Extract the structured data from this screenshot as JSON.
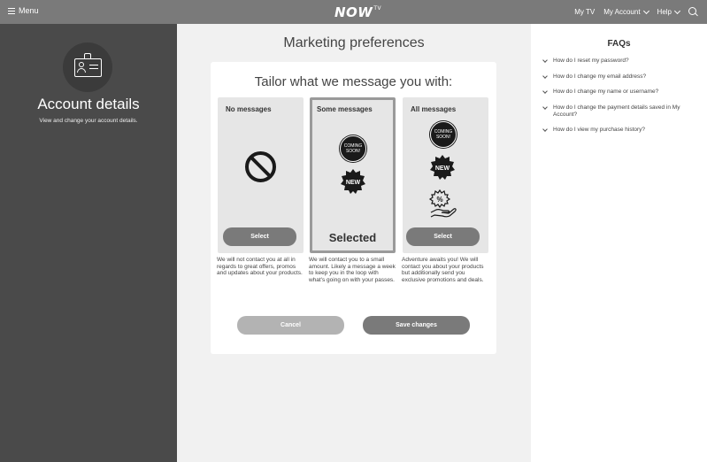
{
  "header": {
    "menu_label": "Menu",
    "logo_text": "NOW",
    "logo_sup": "TV",
    "nav": [
      {
        "label": "My TV"
      },
      {
        "label": "My Account"
      },
      {
        "label": "Help"
      }
    ],
    "icons": [
      "hamburger-icon",
      "chevron-down-icon",
      "search-icon"
    ]
  },
  "sidebar": {
    "title": "Account details",
    "subtitle": "View and change your account details.",
    "icon": "account-card-icon"
  },
  "main": {
    "title": "Marketing preferences",
    "card_heading": "Tailor what we message you with:",
    "options": [
      {
        "label": "No messages",
        "button": "Select",
        "description": "We will not contact you at all in regards to great offers, promos and updates about your products.",
        "icons": [
          "no-entry-icon"
        ]
      },
      {
        "label": "Some messages",
        "selected_text": "Selected",
        "description": "We will contact you to a small amount. Likely a message a week to keep you in the loop with what's going on with your passes.",
        "icons": [
          "coming-soon-icon",
          "new-badge-icon"
        ],
        "coming_soon": "COMING SOON!",
        "new": "NEW"
      },
      {
        "label": "All messages",
        "button": "Select",
        "description": "Adventure awaits you! We will contact you about your products but additionally send you exclusive promotions and deals.",
        "icons": [
          "coming-soon-icon",
          "new-badge-icon",
          "discount-hand-icon"
        ],
        "coming_soon": "COMING SOON!",
        "new": "NEW"
      }
    ],
    "cancel_label": "Cancel",
    "save_label": "Save changes"
  },
  "faq": {
    "title": "FAQs",
    "items": [
      {
        "label": "How do I reset my password?"
      },
      {
        "label": "How do I change my email address?"
      },
      {
        "label": "How do I change my name or username?"
      },
      {
        "label": "How do I change the payment details saved in My Account?"
      },
      {
        "label": "How do I view my purchase history?"
      }
    ]
  },
  "colors": {
    "header_bg": "#7a7a7a",
    "sidebar_bg": "#4a4a4a",
    "main_bg": "#f1f1f1",
    "button_bg": "#7a7a7a",
    "cancel_bg": "#b3b3b3"
  }
}
